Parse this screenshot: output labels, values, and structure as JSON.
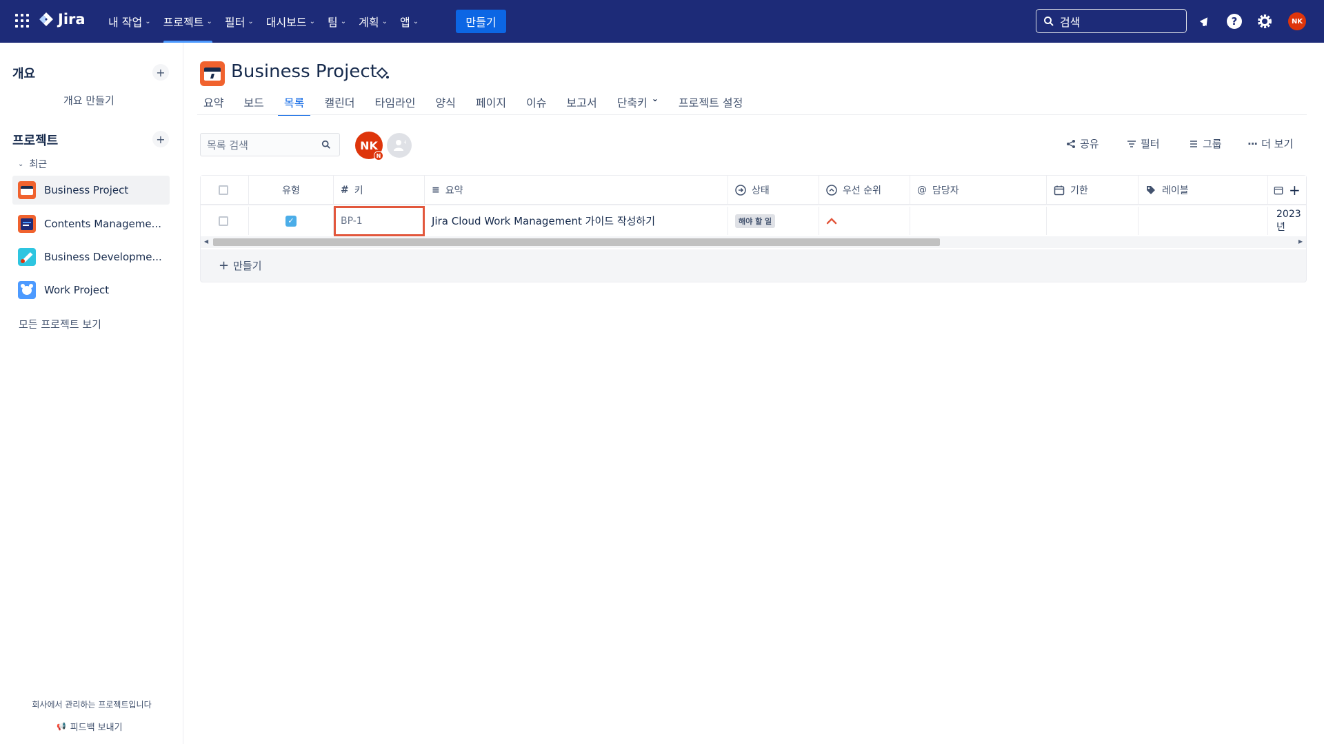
{
  "topnav": {
    "brand": "Jira",
    "menu": [
      {
        "label": "내 작업"
      },
      {
        "label": "프로젝트"
      },
      {
        "label": "필터"
      },
      {
        "label": "대시보드"
      },
      {
        "label": "팀"
      },
      {
        "label": "계획"
      },
      {
        "label": "앱"
      }
    ],
    "active_menu": "프로젝트",
    "create_label": "만들기",
    "search_placeholder": "검색",
    "avatar_initials": "NK"
  },
  "sidebar": {
    "overview_heading": "개요",
    "overview_create": "개요 만들기",
    "projects_heading": "프로젝트",
    "recent_label": "최근",
    "projects": [
      {
        "name": "Business Project",
        "icon": "briefcase-project-icon",
        "color": "#f0622e"
      },
      {
        "name": "Contents Manageme...",
        "icon": "document-project-icon",
        "color": "#f0622e"
      },
      {
        "name": "Business Developme...",
        "icon": "rocket-project-icon",
        "color": "#2ec5e0"
      },
      {
        "name": "Work Project",
        "icon": "bear-project-icon",
        "color": "#4c9aff"
      }
    ],
    "all_projects": "모든 프로젝트 보기",
    "footer_text": "회사에서 관리하는 프로젝트입니다",
    "feedback": "피드백 보내기"
  },
  "project": {
    "title": "Business Project",
    "tabs": [
      "요약",
      "보드",
      "목록",
      "캘린더",
      "타임라인",
      "양식",
      "페이지",
      "이슈",
      "보고서",
      "단축키",
      "프로젝트 설정"
    ],
    "active_tab": "목록"
  },
  "toolbar": {
    "search_placeholder": "목록 검색",
    "avatar_initials": "NK",
    "avatar_sub": "N",
    "share": "공유",
    "filter": "필터",
    "group": "그룹",
    "more": "더 보기"
  },
  "table": {
    "columns": [
      "유형",
      "키",
      "요약",
      "상태",
      "우선 순위",
      "담당자",
      "기한",
      "레이블"
    ],
    "rows": [
      {
        "key": "BP-1",
        "summary": "Jira Cloud Work Management 가이드 작성하기",
        "status": "해야 할 일",
        "priority": "high",
        "assignee": "",
        "due": "",
        "labels": "",
        "created_truncated": "2023년"
      }
    ],
    "create_label": "만들기"
  },
  "colors": {
    "nav_bg": "#1d2b78",
    "accent": "#0c66e4",
    "priority_high": "#e2573c",
    "highlight_border": "#e2573c"
  }
}
